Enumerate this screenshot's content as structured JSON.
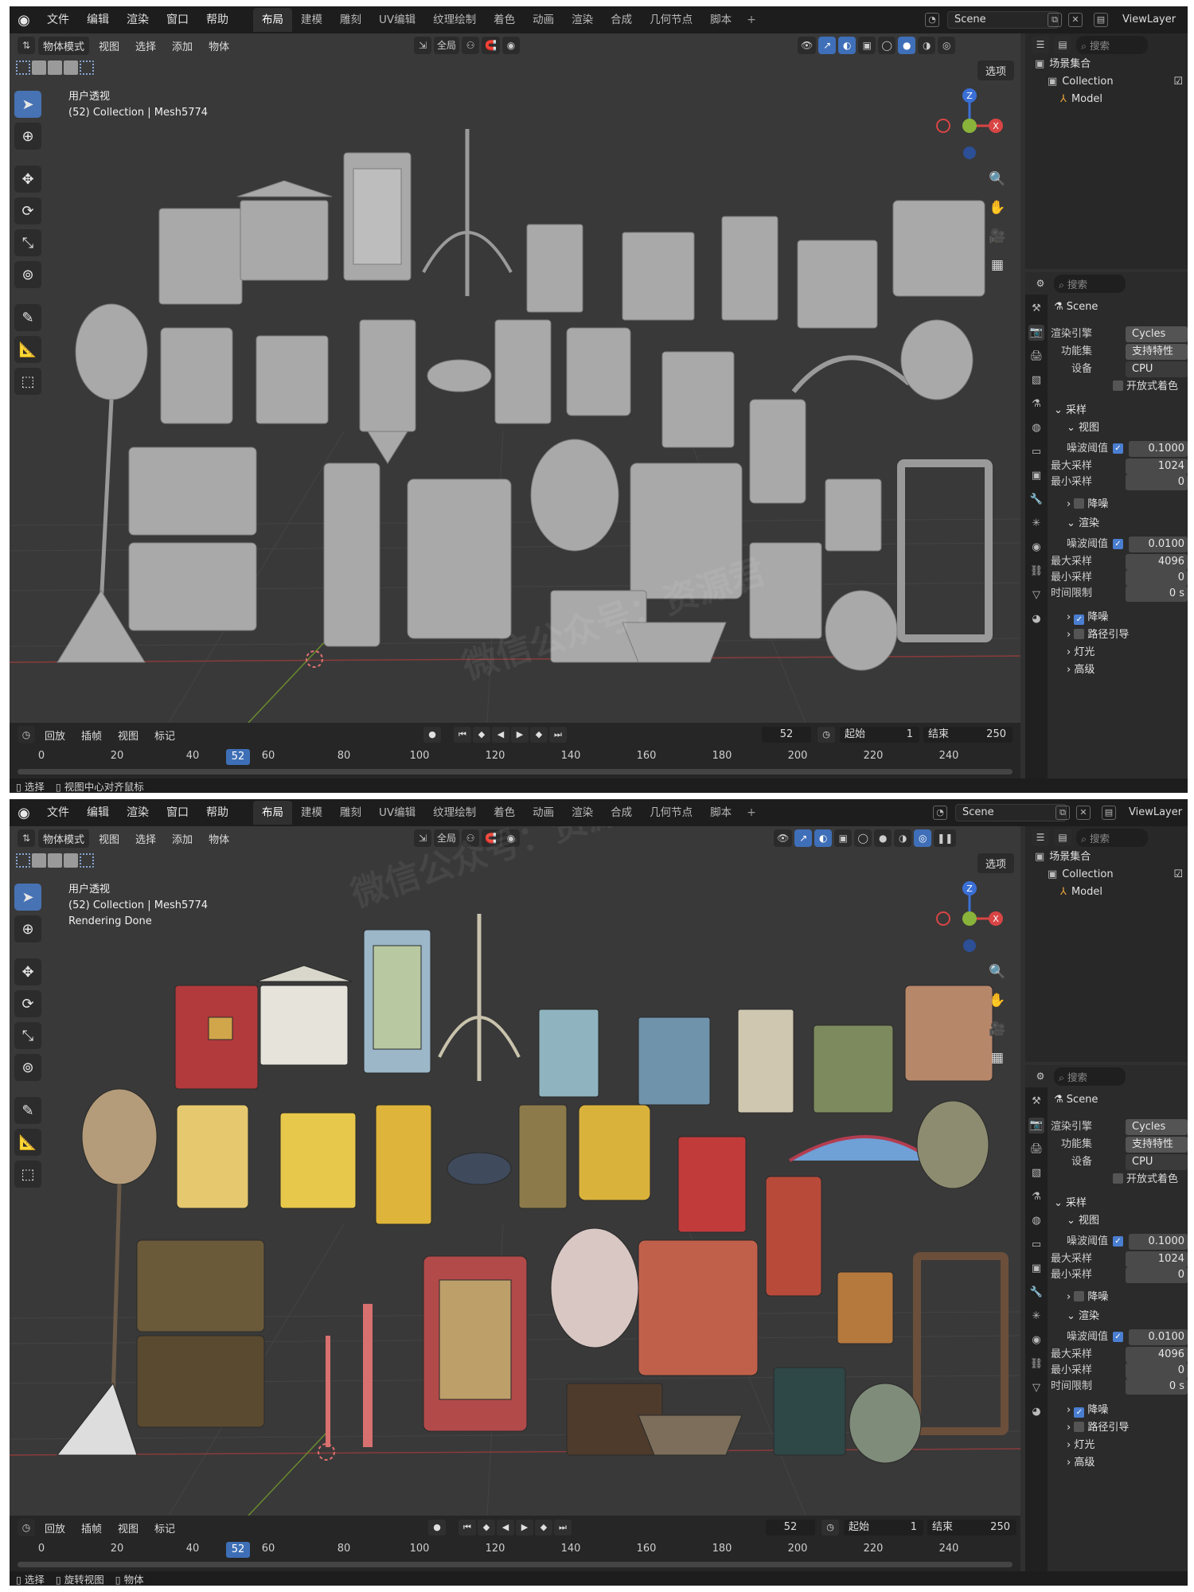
{
  "menu": [
    "文件",
    "编辑",
    "渲染",
    "窗口",
    "帮助"
  ],
  "workspaces": [
    "布局",
    "建模",
    "雕刻",
    "UV编辑",
    "纹理绘制",
    "着色",
    "动画",
    "渲染",
    "合成",
    "几何节点",
    "脚本"
  ],
  "scene_name": "Scene",
  "view_layer": "ViewLayer",
  "viewport_header": {
    "mode": "物体模式",
    "menus": [
      "视图",
      "选择",
      "添加",
      "物体"
    ],
    "transform": "全局",
    "options": "选项"
  },
  "shot1": {
    "info_lines": [
      "用户透视",
      "(52) Collection | Mesh5774"
    ],
    "status_items": [
      "选择",
      "视图中心对齐鼠标"
    ],
    "watermark": "微信公众号：资源君",
    "mesh_color": "#a9a9a9"
  },
  "shot2": {
    "info_lines": [
      "用户透视",
      "(52) Collection | Mesh5774",
      "Rendering Done"
    ],
    "status_items": [
      "选择",
      "旋转视图",
      "物体"
    ],
    "watermark": "微信公众号：资源君"
  },
  "timeline": {
    "menus": [
      "回放",
      "插帧",
      "视图",
      "标记"
    ],
    "current_frame": "52",
    "start_label": "起始",
    "start": "1",
    "end_label": "结束",
    "end": "250",
    "ticks": [
      "0",
      "20",
      "40",
      "60",
      "80",
      "100",
      "120",
      "140",
      "160",
      "180",
      "200",
      "220",
      "240"
    ]
  },
  "outliner": {
    "search_placeholder": "搜索",
    "scene_collection": "场景集合",
    "collection": "Collection",
    "model": "Model"
  },
  "properties": {
    "search_placeholder": "搜索",
    "scene": "Scene",
    "render_engine_label": "渲染引擎",
    "render_engine": "Cycles",
    "feature_set_label": "功能集",
    "feature_set": "支持特性",
    "device_label": "设备",
    "device": "CPU",
    "open_shading": "开放式着色",
    "sampling": "采样",
    "viewport": "视图",
    "noise_threshold_label": "噪波阈值",
    "vp_noise_threshold": "0.1000",
    "max_samples_label": "最大采样",
    "vp_max_samples": "1024",
    "min_samples_label": "最小采样",
    "vp_min_samples": "0",
    "denoise": "降噪",
    "render": "渲染",
    "r_noise_threshold": "0.0100",
    "r_max_samples": "4096",
    "r_min_samples": "0",
    "time_limit_label": "时间限制",
    "time_limit": "0 s",
    "path_guiding": "路径引导",
    "lights": "灯光",
    "advanced": "高级"
  },
  "colors": {
    "accent": "#4772b3",
    "viewport_bg": "#393939",
    "grid_x_axis": "#8a3b3b",
    "grid_y_axis": "#6b8a2e",
    "model_icon": "#e8a43a"
  }
}
